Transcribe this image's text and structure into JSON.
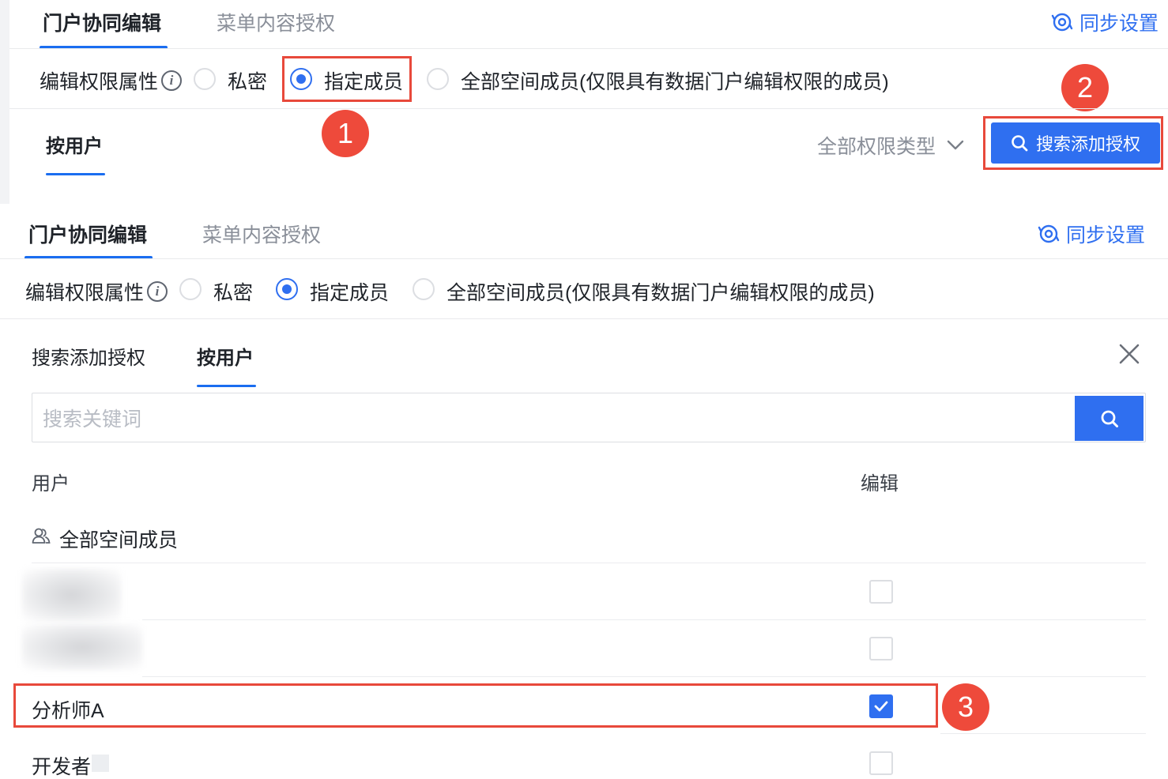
{
  "panel_top": {
    "tabs": [
      {
        "label": "门户协同编辑",
        "active": true
      },
      {
        "label": "菜单内容授权",
        "active": false
      }
    ],
    "sync_label": "同步设置",
    "permission": {
      "label": "编辑权限属性",
      "info_icon": "info-icon",
      "options": [
        {
          "label": "私密",
          "checked": false
        },
        {
          "label": "指定成员",
          "checked": true
        },
        {
          "label": "全部空间成员(仅限具有数据门户编辑权限的成员)",
          "checked": false
        }
      ]
    },
    "subtab": {
      "label": "按用户",
      "active": true
    },
    "filter_label": "全部权限类型",
    "add_button_label": "搜索添加授权",
    "badges": [
      "1",
      "2"
    ]
  },
  "panel_bottom": {
    "tabs": [
      {
        "label": "门户协同编辑",
        "active": true
      },
      {
        "label": "菜单内容授权",
        "active": false
      }
    ],
    "sync_label": "同步设置",
    "permission": {
      "label": "编辑权限属性",
      "options": [
        {
          "label": "私密",
          "checked": false
        },
        {
          "label": "指定成员",
          "checked": true
        },
        {
          "label": "全部空间成员(仅限具有数据门户编辑权限的成员)",
          "checked": false
        }
      ]
    },
    "drawer_tabs": [
      {
        "label": "搜索添加授权",
        "active": false
      },
      {
        "label": "按用户",
        "active": true
      }
    ],
    "search": {
      "placeholder": "搜索关键词"
    },
    "table": {
      "columns": [
        "用户",
        "编辑"
      ],
      "group_row": {
        "label": "全部空间成员",
        "icon": "group-users-icon"
      },
      "rows": [
        {
          "name": "",
          "blurred": true,
          "edit": false
        },
        {
          "name": "",
          "blurred": true,
          "edit": false
        },
        {
          "name": "分析师A",
          "blurred": false,
          "edit": true
        },
        {
          "name": "开发者",
          "blurred": false,
          "edit": false
        }
      ]
    },
    "badges": [
      "3"
    ]
  },
  "colors": {
    "primary": "#2f6ff0",
    "annotation_red": "#ee4a3b",
    "text": "#1f2329",
    "muted": "#8a8f99"
  }
}
